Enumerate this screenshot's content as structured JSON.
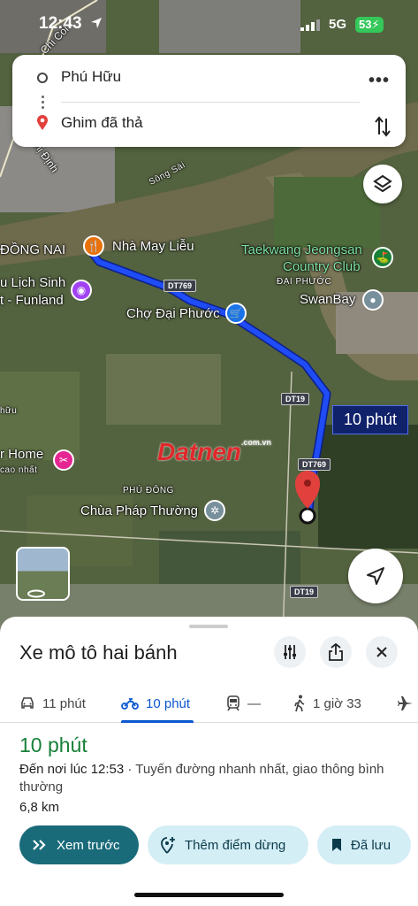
{
  "status_bar": {
    "time": "12:43",
    "network": "5G",
    "battery": "53"
  },
  "search": {
    "origin": "Phú Hữu",
    "destination": "Ghim đã thả"
  },
  "map_labels": {
    "dong_nai": "ĐỒNG NAI",
    "nha_may_lieu": "Nhà May Liễu",
    "lich_sinh": "u Lịch Sinh",
    "funland": "t - Funland",
    "cho_dai_phuoc": "Chợ Đại Phước",
    "taekwang_1": "Taekwang Jeongsan",
    "taekwang_2": "Country Club",
    "dai_phuoc": "ĐẠI PHƯỚC",
    "swanbay": "SwanBay",
    "huu": "hữu",
    "r_home": "r Home",
    "cao_nhat": "cao nhất",
    "phu_dong": "PHÚ ĐÔNG",
    "chua_phap_thuong": "Chùa Pháp Thường",
    "song_sai": "Sông Sài",
    "thi_dinh": "Thị Định",
    "chi_coi": "Chi Coi",
    "route_time": "10 phút",
    "watermark": "Datnen",
    "watermark_sub": ".com.vn"
  },
  "road_shields": [
    "DT769",
    "DT19",
    "DT769",
    "DT19"
  ],
  "sheet": {
    "title": "Xe mô tô hai bánh",
    "tabs": [
      {
        "label": "11 phút",
        "mode": "car"
      },
      {
        "label": "10 phút",
        "mode": "motorbike"
      },
      {
        "label": "—",
        "mode": "transit"
      },
      {
        "label": "1 giờ 33",
        "mode": "walk"
      }
    ],
    "duration": "10 phút",
    "arrive_prefix": "Đến nơi lúc 12:53",
    "arrive_desc": " · Tuyến đường nhanh nhất, giao thông bình thường",
    "distance": "6,8 km",
    "buttons": {
      "preview": "Xem trước",
      "add_stop": "Thêm điểm dừng",
      "saved": "Đã lưu"
    }
  },
  "colors": {
    "route": "#1f4cf5",
    "accent": "#0b57d0",
    "duration_green": "#188038",
    "primary_button": "#1a6b7a",
    "secondary_button": "#d4eef6",
    "pin": "#e2403d"
  }
}
